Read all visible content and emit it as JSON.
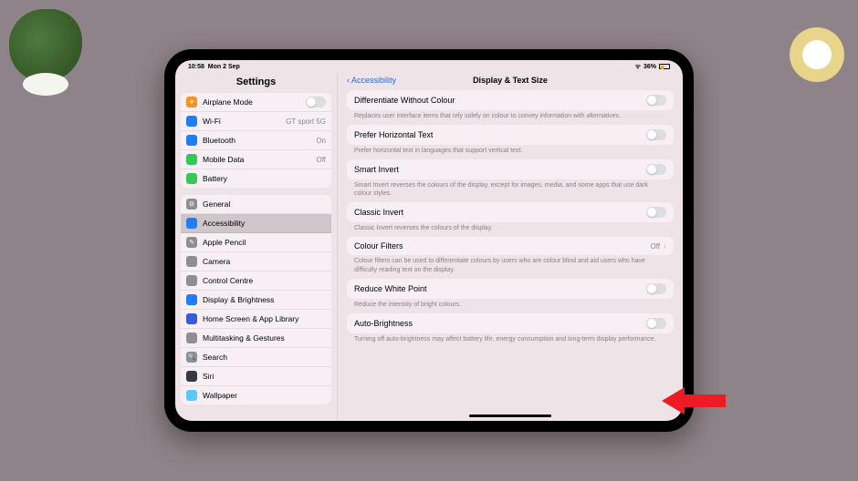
{
  "statusbar": {
    "time": "10:58",
    "date": "Mon 2 Sep",
    "battery": "36%"
  },
  "sidebar": {
    "title": "Settings",
    "group1": [
      {
        "icon": "✈",
        "bg": "#f5941f",
        "label": "Airplane Mode",
        "toggle": true
      },
      {
        "icon": "",
        "bg": "#1f7df5",
        "label": "Wi-Fi",
        "value": "GT sport 5G"
      },
      {
        "icon": "",
        "bg": "#1f7df5",
        "label": "Bluetooth",
        "value": "On"
      },
      {
        "icon": "",
        "bg": "#34c759",
        "label": "Mobile Data",
        "value": "Off"
      },
      {
        "icon": "",
        "bg": "#34c759",
        "label": "Battery",
        "value": ""
      }
    ],
    "group2": [
      {
        "icon": "⚙",
        "bg": "#8e8e93",
        "label": "General"
      },
      {
        "icon": "",
        "bg": "#1f7df5",
        "label": "Accessibility",
        "selected": true
      },
      {
        "icon": "✎",
        "bg": "#8e8e93",
        "label": "Apple Pencil"
      },
      {
        "icon": "",
        "bg": "#8e8e93",
        "label": "Camera"
      },
      {
        "icon": "",
        "bg": "#8e8e93",
        "label": "Control Centre"
      },
      {
        "icon": "",
        "bg": "#1f7df5",
        "label": "Display & Brightness"
      },
      {
        "icon": "",
        "bg": "#3b5bdb",
        "label": "Home Screen & App Library"
      },
      {
        "icon": "",
        "bg": "#8e8e93",
        "label": "Multitasking & Gestures"
      },
      {
        "icon": "🔍",
        "bg": "#8e8e93",
        "label": "Search"
      },
      {
        "icon": "",
        "bg": "#36393f",
        "label": "Siri"
      },
      {
        "icon": "",
        "bg": "#5ac8fa",
        "label": "Wallpaper"
      }
    ]
  },
  "main": {
    "back": "Accessibility",
    "title": "Display & Text Size",
    "items": [
      {
        "label": "Differentiate Without Colour",
        "toggle": true,
        "desc": "Replaces user interface items that rely solely on colour to convey information with alternatives."
      },
      {
        "label": "Prefer Horizontal Text",
        "toggle": true,
        "desc": "Prefer horizontal text in languages that support vertical text."
      },
      {
        "label": "Smart Invert",
        "toggle": true,
        "desc": "Smart Invert reverses the colours of the display, except for images, media, and some apps that use dark colour styles."
      },
      {
        "label": "Classic Invert",
        "toggle": true,
        "desc": "Classic Invert reverses the colours of the display."
      },
      {
        "label": "Colour Filters",
        "value": "Off",
        "chevron": true,
        "desc": "Colour filters can be used to differentiate colours by users who are colour blind and aid users who have difficulty reading text on the display."
      },
      {
        "label": "Reduce White Point",
        "toggle": true,
        "desc": "Reduce the intensity of bright colours."
      },
      {
        "label": "Auto-Brightness",
        "toggle": true,
        "desc": "Turning off auto-brightness may affect battery life, energy consumption and long-term display performance."
      }
    ]
  }
}
